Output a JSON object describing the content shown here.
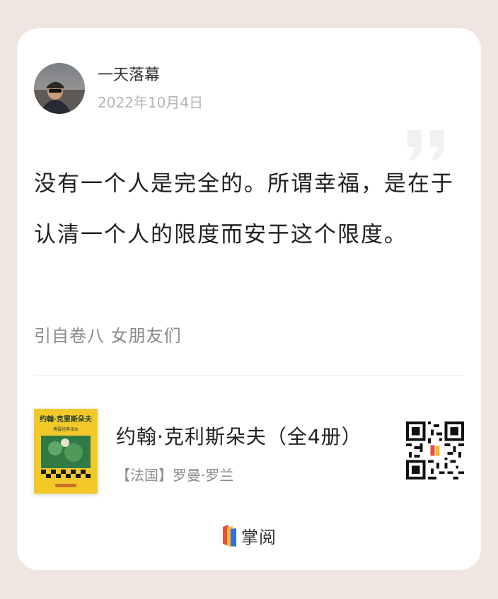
{
  "author": {
    "name": "一天落幕",
    "date": "2022年10月4日"
  },
  "quote": {
    "text": "没有一个人是完全的。所谓幸福，是在于认清一个人的限度而安于这个限度。",
    "source": "引自卷八 女朋友们"
  },
  "book": {
    "title": "约翰·克利斯朵夫（全4册）",
    "author": "【法国】罗曼·罗兰",
    "cover_title": "约翰·克里斯朵夫",
    "cover_subtitle": "傅雷经典译本"
  },
  "brand": {
    "name": "掌阅"
  },
  "colors": {
    "background": "#efe6e1",
    "card": "#ffffff",
    "cover": "#f3c92a",
    "brand_blue": "#2f6fe0",
    "brand_red": "#e84e3c",
    "brand_yellow": "#f7b733"
  },
  "icons": {
    "quote": "closing-quote-icon",
    "qr": "qr-code-icon",
    "logo": "zhangyue-logo-icon"
  }
}
